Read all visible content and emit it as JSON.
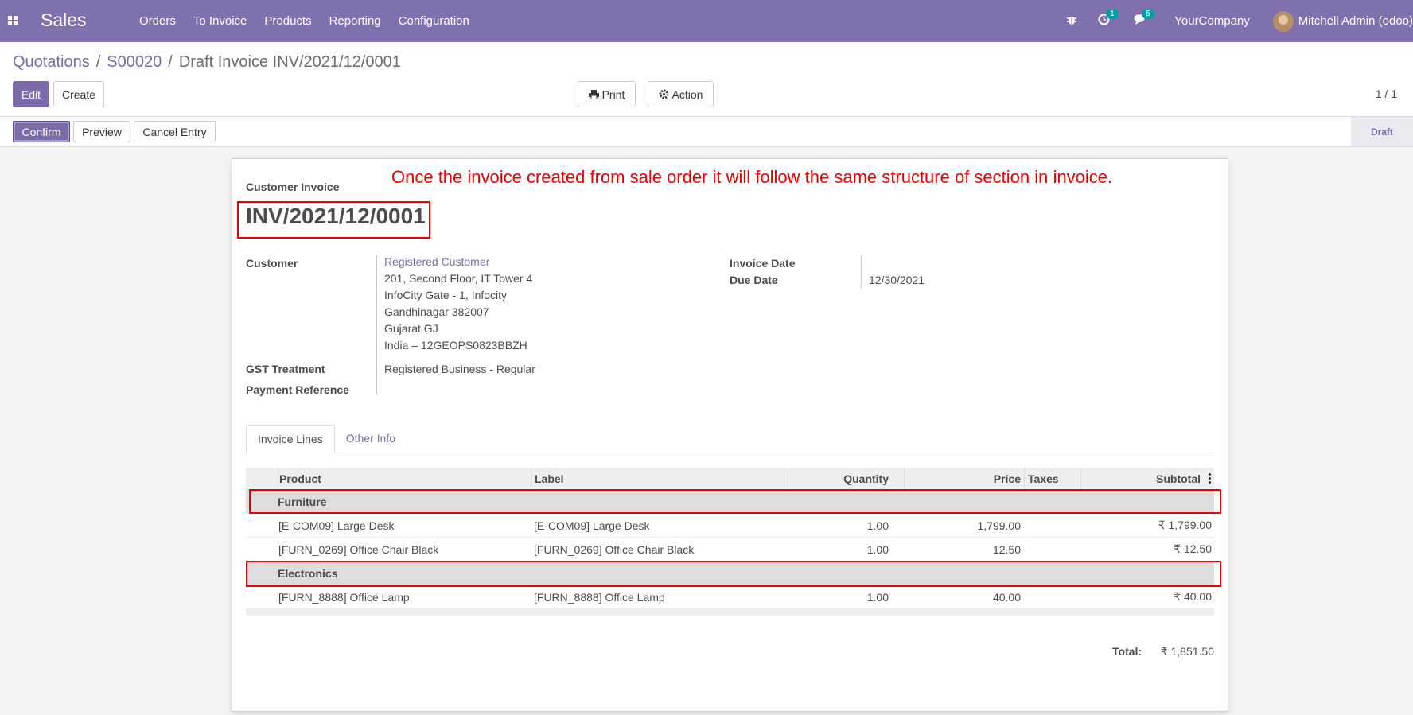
{
  "navbar": {
    "app_name": "Sales",
    "menu": [
      "Orders",
      "To Invoice",
      "Products",
      "Reporting",
      "Configuration"
    ],
    "activity_badge": "1",
    "messages_badge": "5",
    "company": "YourCompany",
    "user": "Mitchell Admin (odoo)",
    "color": "#8071ae"
  },
  "breadcrumb": {
    "items": [
      "Quotations",
      "S00020"
    ],
    "current": "Draft Invoice INV/2021/12/0001"
  },
  "toolbar": {
    "edit": "Edit",
    "create": "Create",
    "print": "Print",
    "action": "Action",
    "pager": "1 / 1"
  },
  "statusbar": {
    "confirm": "Confirm",
    "preview": "Preview",
    "cancel": "Cancel Entry",
    "stage": "Draft"
  },
  "annotation": "Once the invoice created from sale order it will follow the same structure of section in invoice.",
  "invoice": {
    "type": "Customer Invoice",
    "number": "INV/2021/12/0001",
    "customer_label": "Customer",
    "customer_name": "Registered Customer",
    "address": [
      "201, Second Floor, IT Tower 4",
      "InfoCity Gate - 1, Infocity",
      "Gandhinagar 382007",
      "Gujarat GJ",
      "India – 12GEOPS0823BBZH"
    ],
    "gst_label": "GST Treatment",
    "gst_value": "Registered Business - Regular",
    "payref_label": "Payment Reference",
    "invoice_date_label": "Invoice Date",
    "due_date_label": "Due Date",
    "due_date": "12/30/2021"
  },
  "tabs": [
    "Invoice Lines",
    "Other Info"
  ],
  "table": {
    "headers": [
      "Product",
      "Label",
      "Quantity",
      "Price",
      "Taxes",
      "Subtotal"
    ],
    "rows": [
      {
        "section": "Furniture"
      },
      {
        "product": "[E-COM09] Large Desk",
        "label": "[E-COM09] Large Desk",
        "qty": "1.00",
        "price": "1,799.00",
        "taxes": "",
        "subtotal": "₹ 1,799.00"
      },
      {
        "product": "[FURN_0269] Office Chair Black",
        "label": "[FURN_0269] Office Chair Black",
        "qty": "1.00",
        "price": "12.50",
        "taxes": "",
        "subtotal": "₹ 12.50"
      },
      {
        "section": "Electronics"
      },
      {
        "product": "[FURN_8888] Office Lamp",
        "label": "[FURN_8888] Office Lamp",
        "qty": "1.00",
        "price": "40.00",
        "taxes": "",
        "subtotal": "₹ 40.00"
      }
    ]
  },
  "total": {
    "label": "Total:",
    "value": "₹ 1,851.50"
  }
}
